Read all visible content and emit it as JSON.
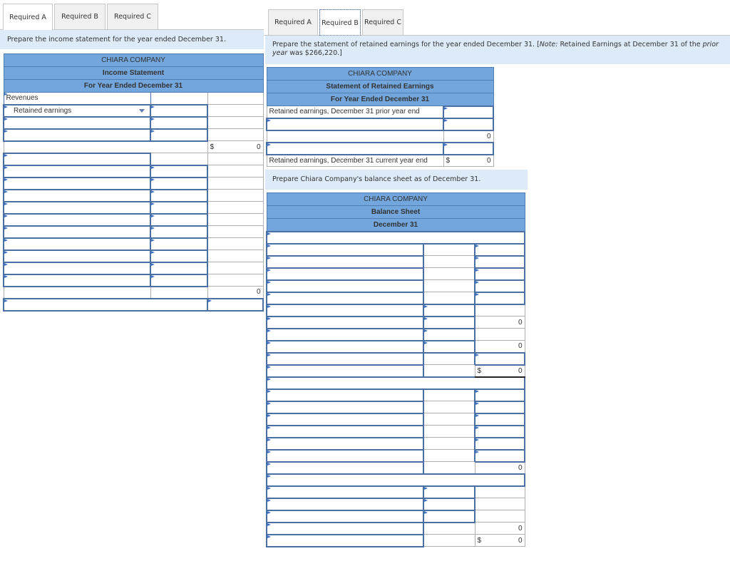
{
  "left": {
    "tabs": [
      {
        "label": "Required A",
        "active": true
      },
      {
        "label": "Required B",
        "active": false
      },
      {
        "label": "Required C",
        "active": false
      }
    ],
    "instruction": "Prepare the income statement for the year ended December 31.",
    "statement": {
      "company": "CHIARA COMPANY",
      "title": "Income Statement",
      "period": "For Year Ended December 31",
      "revenues_label": "Revenues",
      "dropdown_value": "Retained earnings",
      "subtotal_dollar": "$",
      "subtotal_value": "0",
      "total_value": "0"
    }
  },
  "right": {
    "tabs": [
      {
        "label": "Required A",
        "active": false
      },
      {
        "label": "Required B",
        "active": true
      },
      {
        "label": "Required C",
        "active": false
      }
    ],
    "instruction_main": "Prepare the statement of retained earnings for the year ended December 31. [",
    "instruction_note_label": "Note:",
    "instruction_mid": " Retained Earnings at December 31 of the ",
    "instruction_italic": "prior year",
    "instruction_end": " was $266,220.]",
    "retained": {
      "company": "CHIARA COMPANY",
      "title": "Statement of Retained Earnings",
      "period": "For Year Ended December 31",
      "row_prior": "Retained earnings, December 31 prior year end",
      "subtotal_value": "0",
      "row_current": "Retained earnings, December 31 current year end",
      "current_dollar": "$",
      "current_value": "0"
    },
    "balance_instruction": "Prepare Chiara Company's balance sheet as of December 31.",
    "balance": {
      "company": "CHIARA COMPANY",
      "title": "Balance Sheet",
      "period": "December 31",
      "values": {
        "r8": "0",
        "r10": "0",
        "r12_dollar": "$",
        "r12": "0",
        "r20": "0",
        "r25": "0",
        "r26_dollar": "$",
        "r26": "0"
      }
    }
  }
}
